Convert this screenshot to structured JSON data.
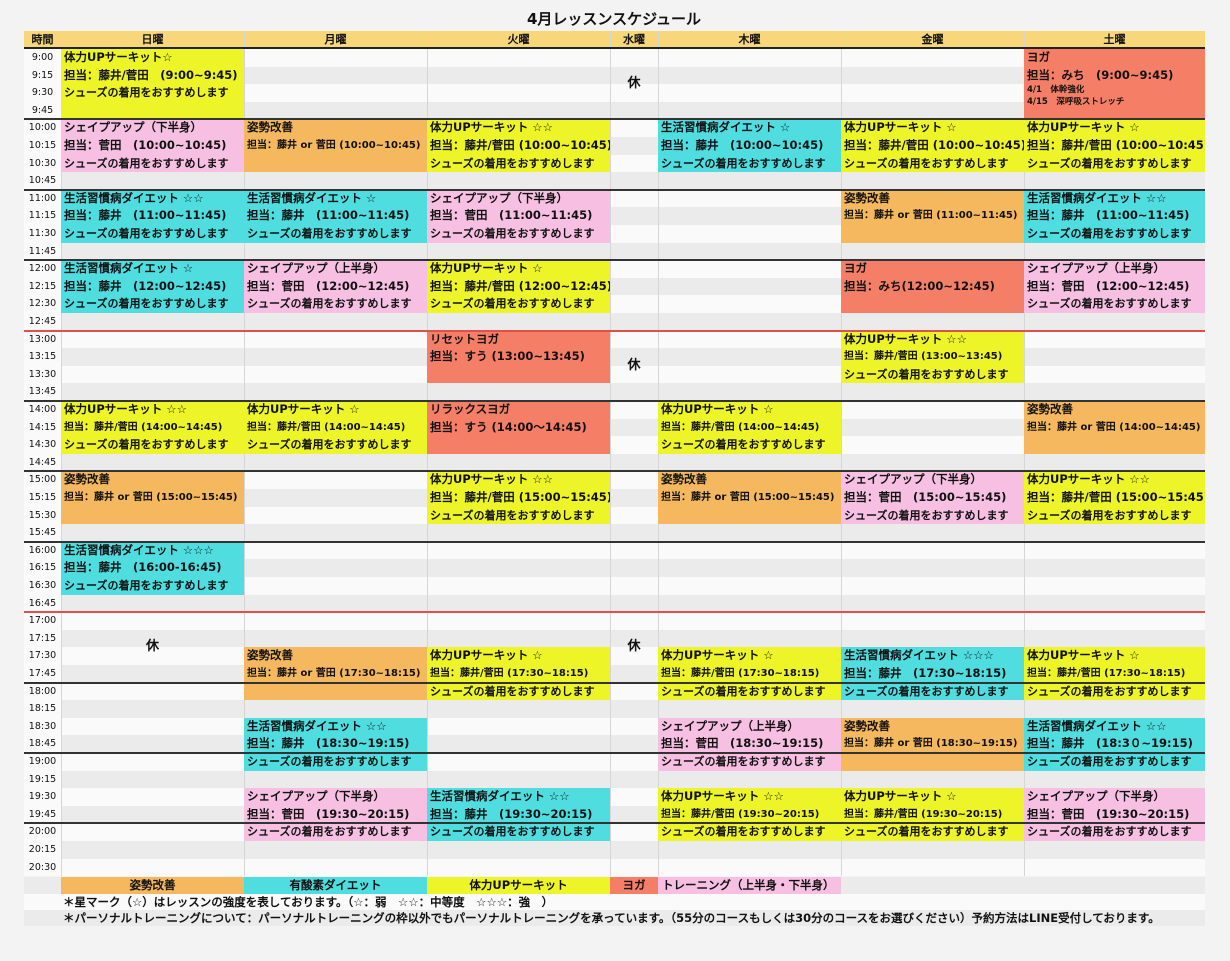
{
  "title": "4月レッスンスケジュール",
  "headers": [
    "時間",
    "日曜",
    "月曜",
    "火曜",
    "水曜",
    "木曜",
    "金曜",
    "土曜"
  ],
  "times": [
    "9:00",
    "9:15",
    "9:30",
    "9:45",
    "10:00",
    "10:15",
    "10:30",
    "10:45",
    "11:00",
    "11:15",
    "11:30",
    "11:45",
    "12:00",
    "12:15",
    "12:30",
    "12:45",
    "13:00",
    "13:15",
    "13:30",
    "13:45",
    "14:00",
    "14:15",
    "14:30",
    "14:45",
    "15:00",
    "15:15",
    "15:30",
    "15:45",
    "16:00",
    "16:15",
    "16:30",
    "16:45",
    "17:00",
    "17:15",
    "17:30",
    "17:45",
    "18:00",
    "18:15",
    "18:30",
    "18:45",
    "19:00",
    "19:15",
    "19:30",
    "19:45",
    "20:00",
    "20:15",
    "20:30"
  ],
  "colors": {
    "posture": "#f5b85e",
    "aerobic": "#4fdde0",
    "circuit": "#edf528",
    "yoga": "#f47e66",
    "training": "#f7c0e2",
    "header": "#f7d77a",
    "grid_even": "#fafafa",
    "grid_odd": "#ebebeb",
    "hour_line": "#333333",
    "noon_line": "#e0504a"
  },
  "rest_label": "休",
  "lessons": [
    {
      "day": 0,
      "start": 0,
      "rows": 4,
      "type": "circuit",
      "lines": [
        {
          "t": "体力UPサーキット☆",
          "s": "name"
        },
        {
          "t": "担当：藤井/菅田　(9:00~9:45)",
          "s": "tr"
        },
        {
          "t": "シューズの着用をおすすめします",
          "s": "note"
        }
      ]
    },
    {
      "day": 6,
      "start": 0,
      "rows": 4,
      "type": "yoga",
      "lines": [
        {
          "t": "ヨガ",
          "s": "name"
        },
        {
          "t": "担当：みち　(9:00~9:45)",
          "s": "tr"
        },
        {
          "t": "4/1　体幹強化",
          "s": "extra"
        },
        {
          "t": "4/15　深呼吸ストレッチ",
          "s": "extra"
        }
      ]
    },
    {
      "day": 0,
      "start": 4,
      "rows": 3,
      "type": "training",
      "lines": [
        {
          "t": "シェイプアップ（下半身）",
          "s": "name"
        },
        {
          "t": "担当：菅田　(10:00~10:45)",
          "s": "tr"
        },
        {
          "t": "シューズの着用をおすすめします",
          "s": "note"
        }
      ]
    },
    {
      "day": 1,
      "start": 4,
      "rows": 3,
      "type": "posture",
      "lines": [
        {
          "t": "姿勢改善",
          "s": "name"
        },
        {
          "t": "担当：藤井 or 菅田 (10:00~10:45)",
          "s": "trs"
        }
      ]
    },
    {
      "day": 2,
      "start": 4,
      "rows": 3,
      "type": "circuit",
      "lines": [
        {
          "t": "体力UPサーキット ☆☆",
          "s": "name"
        },
        {
          "t": "担当：藤井/菅田 (10:00~10:45)",
          "s": "tr"
        },
        {
          "t": "シューズの着用をおすすめします",
          "s": "note"
        }
      ]
    },
    {
      "day": 4,
      "start": 4,
      "rows": 3,
      "type": "aerobic",
      "lines": [
        {
          "t": "生活習慣病ダイエット ☆",
          "s": "name"
        },
        {
          "t": "担当：藤井　(10:00~10:45)",
          "s": "tr"
        },
        {
          "t": "シューズの着用をおすすめします",
          "s": "note"
        }
      ]
    },
    {
      "day": 5,
      "start": 4,
      "rows": 3,
      "type": "circuit",
      "lines": [
        {
          "t": "体力UPサーキット ☆",
          "s": "name"
        },
        {
          "t": "担当：藤井/菅田 (10:00~10:45)",
          "s": "tr"
        },
        {
          "t": "シューズの着用をおすすめします",
          "s": "note"
        }
      ]
    },
    {
      "day": 6,
      "start": 4,
      "rows": 3,
      "type": "circuit",
      "lines": [
        {
          "t": "体力UPサーキット ☆",
          "s": "name"
        },
        {
          "t": "担当：藤井/菅田 (10:00~10:45)",
          "s": "tr"
        },
        {
          "t": "シューズの着用をおすすめします",
          "s": "note"
        }
      ]
    },
    {
      "day": 0,
      "start": 8,
      "rows": 3,
      "type": "aerobic",
      "lines": [
        {
          "t": "生活習慣病ダイエット ☆☆",
          "s": "name"
        },
        {
          "t": "担当：藤井　(11:00~11:45)",
          "s": "tr"
        },
        {
          "t": "シューズの着用をおすすめします",
          "s": "note"
        }
      ]
    },
    {
      "day": 1,
      "start": 8,
      "rows": 3,
      "type": "aerobic",
      "lines": [
        {
          "t": "生活習慣病ダイエット ☆",
          "s": "name"
        },
        {
          "t": "担当：藤井　(11:00~11:45)",
          "s": "tr"
        },
        {
          "t": "シューズの着用をおすすめします",
          "s": "note"
        }
      ]
    },
    {
      "day": 2,
      "start": 8,
      "rows": 3,
      "type": "training",
      "lines": [
        {
          "t": "シェイプアップ（下半身）",
          "s": "name"
        },
        {
          "t": "担当：菅田　(11:00~11:45)",
          "s": "tr"
        },
        {
          "t": "シューズの着用をおすすめします",
          "s": "note"
        }
      ]
    },
    {
      "day": 5,
      "start": 8,
      "rows": 3,
      "type": "posture",
      "lines": [
        {
          "t": "姿勢改善",
          "s": "name"
        },
        {
          "t": "担当：藤井 or 菅田 (11:00~11:45)",
          "s": "trs"
        }
      ]
    },
    {
      "day": 6,
      "start": 8,
      "rows": 3,
      "type": "aerobic",
      "lines": [
        {
          "t": "生活習慣病ダイエット ☆☆",
          "s": "name"
        },
        {
          "t": "担当：藤井　(11:00~11:45)",
          "s": "tr"
        },
        {
          "t": "シューズの着用をおすすめします",
          "s": "note"
        }
      ]
    },
    {
      "day": 0,
      "start": 12,
      "rows": 3,
      "type": "aerobic",
      "lines": [
        {
          "t": "生活習慣病ダイエット ☆",
          "s": "name"
        },
        {
          "t": "担当：藤井　(12:00~12:45)",
          "s": "tr"
        },
        {
          "t": "シューズの着用をおすすめします",
          "s": "note"
        }
      ]
    },
    {
      "day": 1,
      "start": 12,
      "rows": 3,
      "type": "training",
      "lines": [
        {
          "t": "シェイプアップ（上半身）",
          "s": "name"
        },
        {
          "t": "担当：菅田　(12:00~12:45)",
          "s": "tr"
        },
        {
          "t": "シューズの着用をおすすめします",
          "s": "note"
        }
      ]
    },
    {
      "day": 2,
      "start": 12,
      "rows": 3,
      "type": "circuit",
      "lines": [
        {
          "t": "体力UPサーキット ☆",
          "s": "name"
        },
        {
          "t": "担当：藤井/菅田 (12:00~12:45)",
          "s": "tr"
        },
        {
          "t": "シューズの着用をおすすめします",
          "s": "note"
        }
      ]
    },
    {
      "day": 5,
      "start": 12,
      "rows": 3,
      "type": "yoga",
      "lines": [
        {
          "t": "ヨガ",
          "s": "name"
        },
        {
          "t": "担当：みち(12:00~12:45)",
          "s": "tr"
        }
      ]
    },
    {
      "day": 6,
      "start": 12,
      "rows": 3,
      "type": "training",
      "lines": [
        {
          "t": "シェイプアップ（上半身）",
          "s": "name"
        },
        {
          "t": "担当：菅田　(12:00~12:45)",
          "s": "tr"
        },
        {
          "t": "シューズの着用をおすすめします",
          "s": "note"
        }
      ]
    },
    {
      "day": 2,
      "start": 16,
      "rows": 3,
      "type": "yoga",
      "lines": [
        {
          "t": "リセットヨガ",
          "s": "name"
        },
        {
          "t": "担当：すう (13:00~13:45)",
          "s": "tr"
        }
      ]
    },
    {
      "day": 5,
      "start": 16,
      "rows": 3,
      "type": "circuit",
      "lines": [
        {
          "t": "体力UPサーキット ☆☆",
          "s": "name"
        },
        {
          "t": "担当：藤井/菅田 (13:00~13:45)",
          "s": "trs"
        },
        {
          "t": "シューズの着用をおすすめします",
          "s": "note"
        }
      ]
    },
    {
      "day": 0,
      "start": 20,
      "rows": 3,
      "type": "circuit",
      "lines": [
        {
          "t": "体力UPサーキット ☆☆",
          "s": "name"
        },
        {
          "t": "担当：藤井/菅田 (14:00~14:45)",
          "s": "trs"
        },
        {
          "t": "シューズの着用をおすすめします",
          "s": "note"
        }
      ]
    },
    {
      "day": 1,
      "start": 20,
      "rows": 3,
      "type": "circuit",
      "lines": [
        {
          "t": "体力UPサーキット ☆",
          "s": "name"
        },
        {
          "t": "担当：藤井/菅田 (14:00~14:45)",
          "s": "trs"
        },
        {
          "t": "シューズの着用をおすすめします",
          "s": "note"
        }
      ]
    },
    {
      "day": 2,
      "start": 20,
      "rows": 3,
      "type": "yoga",
      "lines": [
        {
          "t": "リラックスヨガ",
          "s": "name"
        },
        {
          "t": "担当：すう (14:00～14:45)",
          "s": "tr"
        }
      ]
    },
    {
      "day": 4,
      "start": 20,
      "rows": 3,
      "type": "circuit",
      "lines": [
        {
          "t": "体力UPサーキット ☆",
          "s": "name"
        },
        {
          "t": "担当：藤井/菅田 (14:00~14:45)",
          "s": "trs"
        },
        {
          "t": "シューズの着用をおすすめします",
          "s": "note"
        }
      ]
    },
    {
      "day": 6,
      "start": 20,
      "rows": 3,
      "type": "posture",
      "lines": [
        {
          "t": "姿勢改善",
          "s": "name"
        },
        {
          "t": "担当：藤井 or 菅田 (14:00~14:45)",
          "s": "trs"
        }
      ]
    },
    {
      "day": 0,
      "start": 24,
      "rows": 3,
      "type": "posture",
      "lines": [
        {
          "t": "姿勢改善",
          "s": "name"
        },
        {
          "t": "担当：藤井 or 菅田 (15:00~15:45)",
          "s": "trs"
        }
      ]
    },
    {
      "day": 2,
      "start": 24,
      "rows": 3,
      "type": "circuit",
      "lines": [
        {
          "t": "体力UPサーキット ☆☆",
          "s": "name"
        },
        {
          "t": "担当：藤井/菅田 (15:00~15:45)",
          "s": "tr"
        },
        {
          "t": "シューズの着用をおすすめします",
          "s": "note"
        }
      ]
    },
    {
      "day": 4,
      "start": 24,
      "rows": 3,
      "type": "posture",
      "lines": [
        {
          "t": "姿勢改善",
          "s": "name"
        },
        {
          "t": "担当：藤井 or 菅田 (15:00~15:45)",
          "s": "trs"
        }
      ]
    },
    {
      "day": 5,
      "start": 24,
      "rows": 3,
      "type": "training",
      "lines": [
        {
          "t": "シェイプアップ（下半身）",
          "s": "name"
        },
        {
          "t": "担当：菅田　(15:00~15:45)",
          "s": "tr"
        },
        {
          "t": "シューズの着用をおすすめします",
          "s": "note"
        }
      ]
    },
    {
      "day": 6,
      "start": 24,
      "rows": 3,
      "type": "circuit",
      "lines": [
        {
          "t": "体力UPサーキット ☆☆",
          "s": "name"
        },
        {
          "t": "担当：藤井/菅田 (15:00~15:45)",
          "s": "tr"
        },
        {
          "t": "シューズの着用をおすすめします",
          "s": "note"
        }
      ]
    },
    {
      "day": 0,
      "start": 28,
      "rows": 3,
      "type": "aerobic",
      "lines": [
        {
          "t": "生活習慣病ダイエット ☆☆☆",
          "s": "name"
        },
        {
          "t": "担当：藤井　(16:00-16:45)",
          "s": "tr"
        },
        {
          "t": "シューズの着用をおすすめします",
          "s": "note"
        }
      ]
    },
    {
      "day": 1,
      "start": 34,
      "rows": 2,
      "type": "posture",
      "lines": [
        {
          "t": "姿勢改善",
          "s": "name"
        },
        {
          "t": "担当：藤井 or 菅田 (17:30~18:15)",
          "s": "trs"
        }
      ]
    },
    {
      "day": 1,
      "start": 36,
      "rows": 1,
      "type": "posture",
      "lines": []
    },
    {
      "day": 2,
      "start": 34,
      "rows": 2,
      "type": "circuit",
      "lines": [
        {
          "t": "体力UPサーキット ☆",
          "s": "name"
        },
        {
          "t": "担当：藤井/菅田 (17:30~18:15)",
          "s": "trs"
        }
      ]
    },
    {
      "day": 2,
      "start": 36,
      "rows": 1,
      "type": "circuit",
      "lines": [
        {
          "t": "シューズの着用をおすすめします",
          "s": "note"
        }
      ]
    },
    {
      "day": 4,
      "start": 34,
      "rows": 2,
      "type": "circuit",
      "lines": [
        {
          "t": "体力UPサーキット ☆",
          "s": "name"
        },
        {
          "t": "担当：藤井/菅田 (17:30~18:15)",
          "s": "trs"
        }
      ]
    },
    {
      "day": 4,
      "start": 36,
      "rows": 1,
      "type": "circuit",
      "lines": [
        {
          "t": "シューズの着用をおすすめします",
          "s": "note"
        }
      ]
    },
    {
      "day": 5,
      "start": 34,
      "rows": 2,
      "type": "aerobic",
      "lines": [
        {
          "t": "生活習慣病ダイエット ☆☆☆",
          "s": "name"
        },
        {
          "t": "担当：藤井　(17:30~18:15)",
          "s": "tr"
        }
      ]
    },
    {
      "day": 5,
      "start": 36,
      "rows": 1,
      "type": "aerobic",
      "lines": [
        {
          "t": "シューズの着用をおすすめします",
          "s": "note"
        }
      ]
    },
    {
      "day": 6,
      "start": 34,
      "rows": 2,
      "type": "circuit",
      "lines": [
        {
          "t": "体力UPサーキット ☆",
          "s": "name"
        },
        {
          "t": "担当：藤井/菅田 (17:30~18:15)",
          "s": "trs"
        }
      ]
    },
    {
      "day": 6,
      "start": 36,
      "rows": 1,
      "type": "circuit",
      "lines": [
        {
          "t": "シューズの着用をおすすめします",
          "s": "note"
        }
      ]
    },
    {
      "day": 1,
      "start": 38,
      "rows": 2,
      "type": "aerobic",
      "lines": [
        {
          "t": "生活習慣病ダイエット ☆☆",
          "s": "name"
        },
        {
          "t": "担当：藤井　(18:30~19:15)",
          "s": "tr"
        }
      ]
    },
    {
      "day": 1,
      "start": 40,
      "rows": 1,
      "type": "aerobic",
      "lines": [
        {
          "t": "シューズの着用をおすすめします",
          "s": "note"
        }
      ]
    },
    {
      "day": 4,
      "start": 38,
      "rows": 2,
      "type": "training",
      "lines": [
        {
          "t": "シェイプアップ（上半身）",
          "s": "name"
        },
        {
          "t": "担当：菅田　(18:30~19:15)",
          "s": "tr"
        }
      ]
    },
    {
      "day": 4,
      "start": 40,
      "rows": 1,
      "type": "training",
      "lines": [
        {
          "t": "シューズの着用をおすすめします",
          "s": "note"
        }
      ]
    },
    {
      "day": 5,
      "start": 38,
      "rows": 2,
      "type": "posture",
      "lines": [
        {
          "t": "姿勢改善",
          "s": "name"
        },
        {
          "t": "担当：藤井 or 菅田 (18:30~19:15)",
          "s": "trs"
        }
      ]
    },
    {
      "day": 5,
      "start": 40,
      "rows": 1,
      "type": "posture",
      "lines": []
    },
    {
      "day": 6,
      "start": 38,
      "rows": 2,
      "type": "aerobic",
      "lines": [
        {
          "t": "生活習慣病ダイエット ☆☆",
          "s": "name"
        },
        {
          "t": "担当：藤井　(18:3０~19:15)",
          "s": "tr"
        }
      ]
    },
    {
      "day": 6,
      "start": 40,
      "rows": 1,
      "type": "aerobic",
      "lines": [
        {
          "t": "シューズの着用をおすすめします",
          "s": "note"
        }
      ]
    },
    {
      "day": 1,
      "start": 42,
      "rows": 2,
      "type": "training",
      "lines": [
        {
          "t": "シェイプアップ（下半身）",
          "s": "name"
        },
        {
          "t": "担当：菅田　(19:30~20:15)",
          "s": "tr"
        }
      ]
    },
    {
      "day": 1,
      "start": 44,
      "rows": 1,
      "type": "training",
      "lines": [
        {
          "t": "シューズの着用をおすすめします",
          "s": "note"
        }
      ]
    },
    {
      "day": 2,
      "start": 42,
      "rows": 2,
      "type": "aerobic",
      "lines": [
        {
          "t": "生活習慣病ダイエット ☆☆",
          "s": "name"
        },
        {
          "t": "担当：藤井　(19:30~20:15)",
          "s": "tr"
        }
      ]
    },
    {
      "day": 2,
      "start": 44,
      "rows": 1,
      "type": "aerobic",
      "lines": [
        {
          "t": "シューズの着用をおすすめします",
          "s": "note"
        }
      ]
    },
    {
      "day": 4,
      "start": 42,
      "rows": 2,
      "type": "circuit",
      "lines": [
        {
          "t": "体力UPサーキット ☆☆",
          "s": "name"
        },
        {
          "t": "担当：藤井/菅田 (19:30~20:15)",
          "s": "trs"
        }
      ]
    },
    {
      "day": 4,
      "start": 44,
      "rows": 1,
      "type": "circuit",
      "lines": [
        {
          "t": "シューズの着用をおすすめします",
          "s": "note"
        }
      ]
    },
    {
      "day": 5,
      "start": 42,
      "rows": 2,
      "type": "circuit",
      "lines": [
        {
          "t": "体力UPサーキット ☆",
          "s": "name"
        },
        {
          "t": "担当：藤井/菅田 (19:30~20:15)",
          "s": "trs"
        }
      ]
    },
    {
      "day": 5,
      "start": 44,
      "rows": 1,
      "type": "circuit",
      "lines": [
        {
          "t": "シューズの着用をおすすめします",
          "s": "note"
        }
      ]
    },
    {
      "day": 6,
      "start": 42,
      "rows": 2,
      "type": "training",
      "lines": [
        {
          "t": "シェイプアップ（下半身）",
          "s": "name"
        },
        {
          "t": "担当：菅田　(19:30~20:15)",
          "s": "tr"
        }
      ]
    },
    {
      "day": 6,
      "start": 44,
      "rows": 1,
      "type": "training",
      "lines": [
        {
          "t": "シューズの着用をおすすめします",
          "s": "note"
        }
      ]
    }
  ],
  "rest_marks": [
    {
      "day": 3,
      "start": 0,
      "rows": 4
    },
    {
      "day": 3,
      "start": 16,
      "rows": 4
    },
    {
      "day": 3,
      "start": 32,
      "rows": 4
    },
    {
      "day": 0,
      "start": 32,
      "rows": 4
    }
  ],
  "legend": [
    {
      "label": "姿勢改善",
      "type": "posture"
    },
    {
      "label": "有酸素ダイエット",
      "type": "aerobic"
    },
    {
      "label": "体力UPサーキット",
      "type": "circuit"
    },
    {
      "label": "ヨガ",
      "type": "yoga"
    },
    {
      "label": "トレーニング（上半身・下半身）",
      "type": "training"
    }
  ],
  "footer": [
    "＊星マーク（☆）はレッスンの強度を表しております。（☆：弱　☆☆：中等度　☆☆☆：強　）",
    "＊パーソナルトレーニングについて：パーソナルトレーニングの枠以外でもパーソナルトレーニングを承っています。（55分のコースもしくは30分のコースをお選びください）予約方法はLINE受付しております。"
  ]
}
